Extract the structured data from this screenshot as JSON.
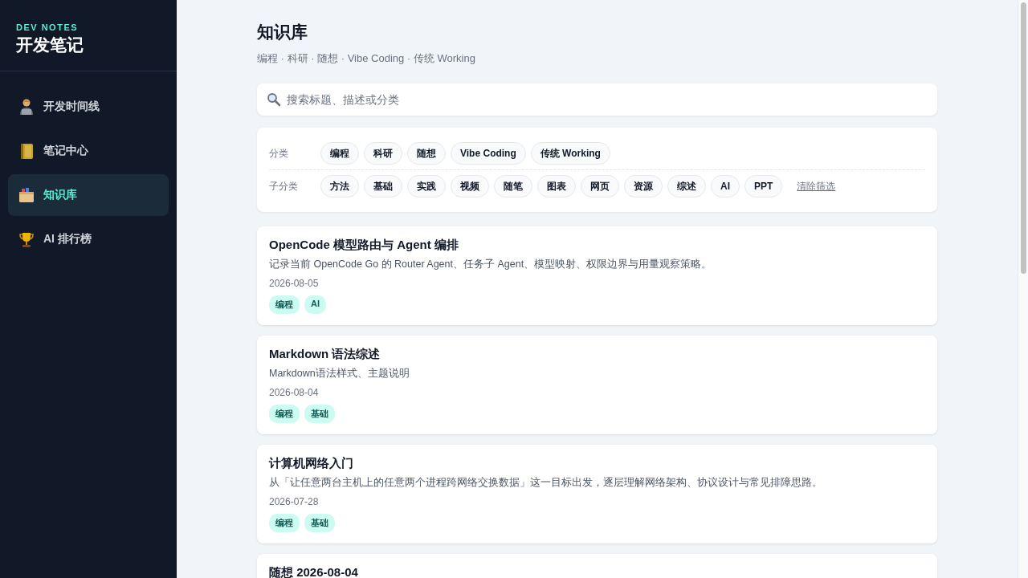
{
  "sidebar": {
    "brand_kicker": "DEV NOTES",
    "brand_title": "开发笔记",
    "items": [
      {
        "label": "开发时间线",
        "selected": false
      },
      {
        "label": "笔记中心",
        "selected": false
      },
      {
        "label": "知识库",
        "selected": true
      },
      {
        "label": "AI 排行榜",
        "selected": false
      }
    ]
  },
  "header": {
    "title": "知识库",
    "subtitle": "编程 · 科研 · 随想 · Vibe Coding · 传统 Working"
  },
  "search": {
    "placeholder": "搜索标题、描述或分类"
  },
  "filters": {
    "rows": [
      {
        "label": "分类",
        "chips": [
          {
            "label": "编程",
            "selected": false
          },
          {
            "label": "科研",
            "selected": false
          },
          {
            "label": "随想",
            "selected": false
          },
          {
            "label": "Vibe Coding",
            "selected": false
          },
          {
            "label": "传统 Working",
            "selected": false
          }
        ]
      },
      {
        "label": "子分类",
        "chips": [
          {
            "label": "方法",
            "selected": false
          },
          {
            "label": "基础",
            "selected": false
          },
          {
            "label": "实践",
            "selected": false
          },
          {
            "label": "视频",
            "selected": false
          },
          {
            "label": "随笔",
            "selected": false
          },
          {
            "label": "图表",
            "selected": false
          },
          {
            "label": "网页",
            "selected": false
          },
          {
            "label": "资源",
            "selected": false
          },
          {
            "label": "综述",
            "selected": false
          },
          {
            "label": "AI",
            "selected": false
          },
          {
            "label": "PPT",
            "selected": false
          }
        ],
        "clear_link": "清除筛选"
      }
    ]
  },
  "articles": [
    {
      "title": "OpenCode 模型路由与 Agent 编排",
      "description": "记录当前 OpenCode Go 的 Router Agent、任务子 Agent、模型映射、权限边界与用量观察策略。",
      "date": "2026-08-05",
      "tags": [
        "编程",
        "AI"
      ]
    },
    {
      "title": "Markdown 语法综述",
      "description": "Markdown语法样式、主题说明",
      "date": "2026-08-04",
      "tags": [
        "编程",
        "基础"
      ]
    },
    {
      "title": "计算机网络入门",
      "description": "从「让任意两台主机上的任意两个进程跨网络交换数据」这一目标出发，逐层理解网络架构、协议设计与常见排障思路。",
      "date": "2026-07-28",
      "tags": [
        "编程",
        "基础"
      ]
    },
    {
      "title": "随想 2026-08-04"
    }
  ]
}
